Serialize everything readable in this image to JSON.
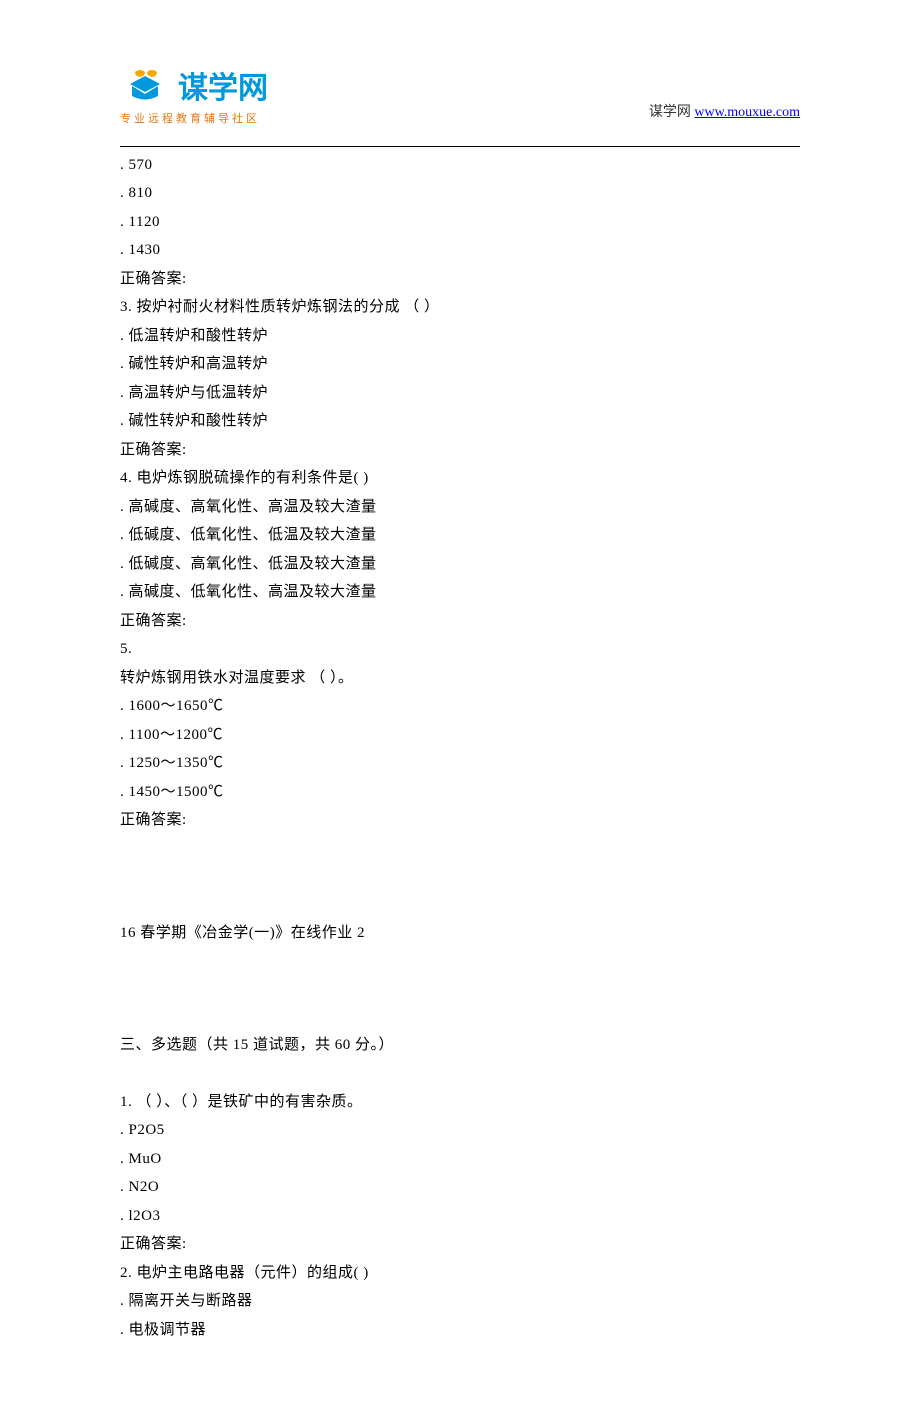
{
  "header": {
    "logo_main": "谋学网",
    "logo_sub": "专业远程教育辅导社区",
    "right_prefix": "谋学网 ",
    "right_link": "www.mouxue.com"
  },
  "q2": {
    "opt1": "570",
    "opt2": "810",
    "opt3": "1120",
    "opt4": "1430",
    "answer_label": "正确答案:"
  },
  "q3": {
    "stem": "3.  按炉衬耐火材料性质转炉炼钢法的分成 （    ）",
    "opt1": "低温转炉和酸性转炉",
    "opt2": "碱性转炉和高温转炉",
    "opt3": "高温转炉与低温转炉",
    "opt4": "碱性转炉和酸性转炉",
    "answer_label": "正确答案:"
  },
  "q4": {
    "stem": "4.  电炉炼钢脱硫操作的有利条件是(    )",
    "opt1": "高碱度、高氧化性、高温及较大渣量",
    "opt2": "低碱度、低氧化性、低温及较大渣量",
    "opt3": "低碱度、高氧化性、低温及较大渣量",
    "opt4": "高碱度、低氧化性、高温及较大渣量",
    "answer_label": "正确答案:"
  },
  "q5": {
    "stem1": "5.",
    "stem2": "转炉炼钢用铁水对温度要求 （    ）。",
    "opt1": "1600～1650℃",
    "opt2": "1100～1200℃",
    "opt3": "1250～1350℃",
    "opt4": "1450～1500℃",
    "answer_label": "正确答案:"
  },
  "title2": "16 春学期《冶金学(一)》在线作业 2",
  "section3": "三、多选题（共 15 道试题，共 60 分。）",
  "m1": {
    "stem": "1. （ ）、（ ）是铁矿中的有害杂质。",
    "opt1": "P2O5",
    "opt2": "MuO",
    "opt3": "N2O",
    "opt4": "l2O3",
    "answer_label": "正确答案:"
  },
  "m2": {
    "stem": "2.  电炉主电路电器（元件）的组成(    )",
    "opt1": "隔离开关与断路器",
    "opt2": "电极调节器"
  }
}
